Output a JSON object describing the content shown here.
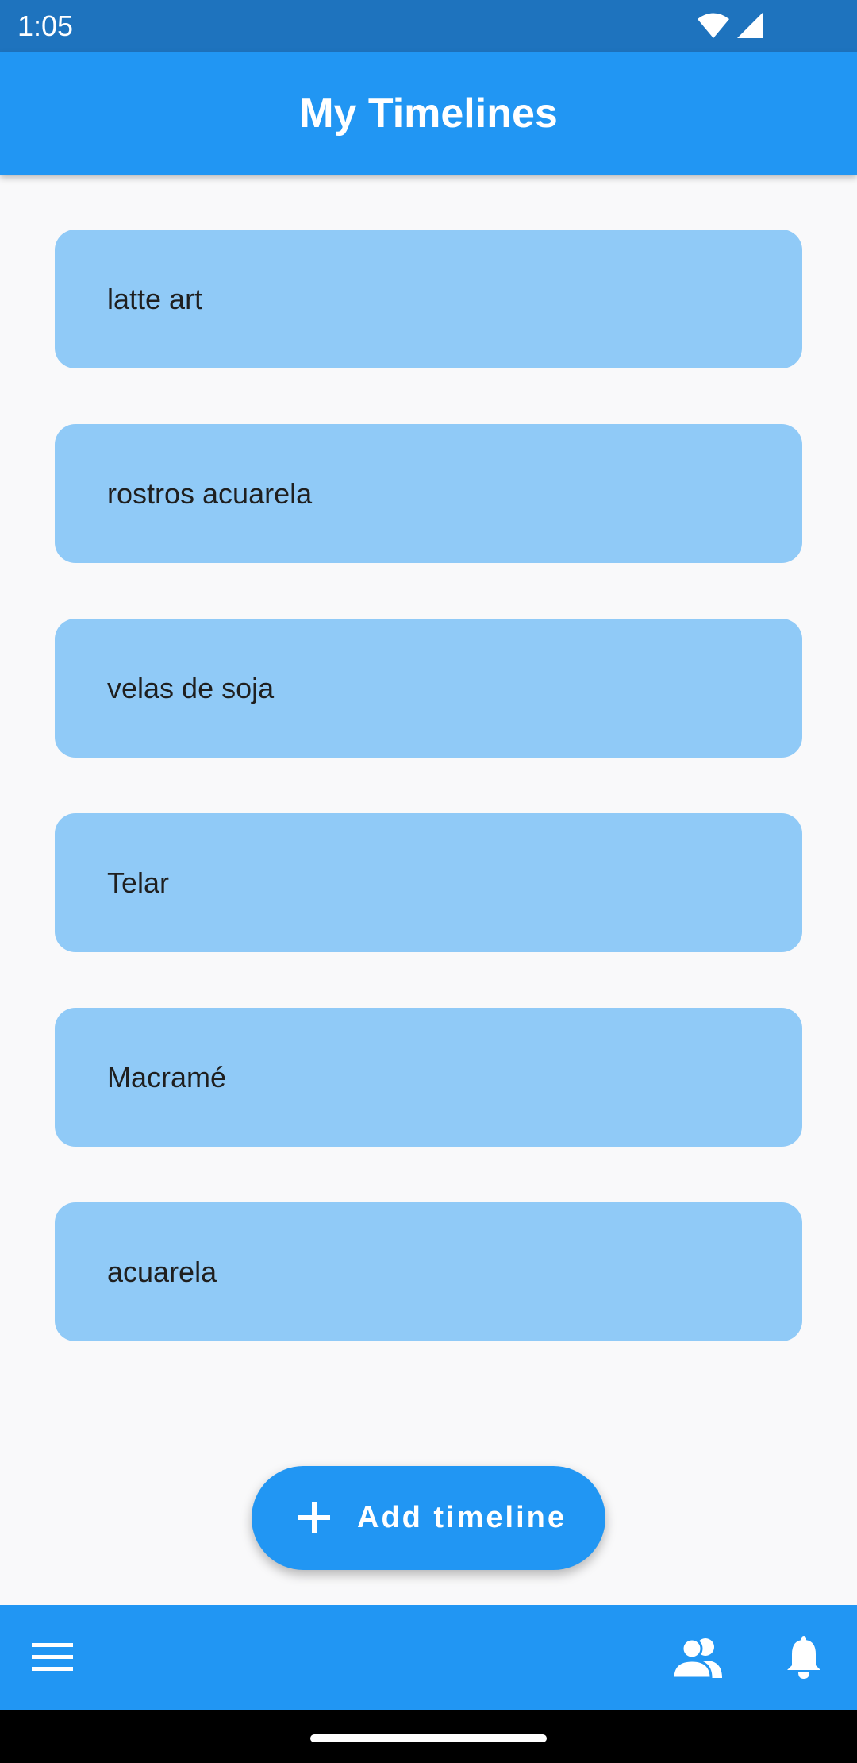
{
  "status_bar": {
    "time": "1:05",
    "icons": [
      "wifi-icon",
      "signal-icon"
    ]
  },
  "app_bar": {
    "title": "My Timelines"
  },
  "timelines": [
    {
      "label": "latte art"
    },
    {
      "label": "rostros acuarela"
    },
    {
      "label": "velas de soja"
    },
    {
      "label": "Telar"
    },
    {
      "label": "Macramé"
    },
    {
      "label": "acuarela"
    }
  ],
  "fab": {
    "label": "Add timeline",
    "icon": "plus-icon"
  },
  "bottom_bar": {
    "icons": [
      "menu-icon",
      "people-icon",
      "bell-icon"
    ]
  },
  "colors": {
    "status_bar": "#1E73BE",
    "primary": "#2196F3",
    "card": "#90CAF7",
    "background": "#F9F9FA"
  }
}
